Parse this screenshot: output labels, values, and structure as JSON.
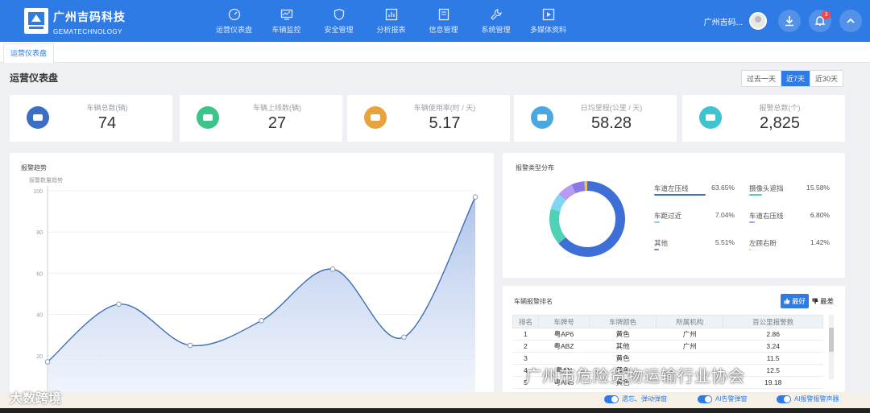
{
  "brand": {
    "name_cn": "广州吉码科技",
    "name_en": "GEMATECHNOLOGY"
  },
  "nav": [
    {
      "label": "运营仪表盘",
      "icon": "dashboard-icon"
    },
    {
      "label": "车辆监控",
      "icon": "monitor-icon"
    },
    {
      "label": "安全管理",
      "icon": "shield-icon"
    },
    {
      "label": "分析报表",
      "icon": "report-icon"
    },
    {
      "label": "信息管理",
      "icon": "document-icon"
    },
    {
      "label": "系统管理",
      "icon": "wrench-icon"
    },
    {
      "label": "多媒体资料",
      "icon": "media-icon"
    }
  ],
  "header": {
    "user_name": "广州吉码...",
    "notification_count": "3"
  },
  "tabs": [
    {
      "label": "运营仪表盘"
    }
  ],
  "page": {
    "title": "运营仪表盘"
  },
  "range": {
    "options": [
      "过去一天",
      "近7天",
      "近30天"
    ],
    "selected": "近7天"
  },
  "stats": [
    {
      "label": "车辆总数(辆)",
      "value": "74",
      "color": "#3b6fc4"
    },
    {
      "label": "车辆上线数(辆)",
      "value": "27",
      "color": "#3cc48a"
    },
    {
      "label": "车辆使用率(时 / 天)",
      "value": "5.17",
      "color": "#e8a33c"
    },
    {
      "label": "日均里程(公里 / 天)",
      "value": "58.28",
      "color": "#4aa8e0"
    },
    {
      "label": "报警总数(个)",
      "value": "2,825",
      "color": "#3fc3cf"
    }
  ],
  "trend": {
    "title": "报警趋势",
    "subtitle": "报警数量趋势"
  },
  "distribution": {
    "title": "报警类型分布"
  },
  "ranking": {
    "title": "车辆报警排名",
    "best_label": "最好",
    "worst_label": "最差",
    "columns": [
      "排名",
      "车牌号",
      "车牌颜色",
      "所属机构",
      "百公里报警数"
    ],
    "rows": [
      [
        "1",
        "粤AP6",
        "黄色",
        "广州",
        "2.86"
      ],
      [
        "2",
        "粤ABZ",
        "其他",
        "广州",
        "3.24"
      ],
      [
        "3",
        "",
        "黄色",
        "",
        "11.5"
      ],
      [
        "4",
        "粤AN",
        "黄色",
        "",
        "12.5"
      ],
      [
        "5",
        "粤AN5",
        "黄色",
        "",
        "19.18"
      ]
    ]
  },
  "bottom": {
    "toggles": [
      "遗忘、弹动弹窗",
      "AI告警弹窗",
      "AI报警报警声器"
    ]
  },
  "watermarks": {
    "left": "大数跨境",
    "right": "广州市危险货物运输行业协会"
  },
  "chart_data": [
    {
      "type": "area",
      "title": "报警趋势",
      "ylabel": "报警数量趋势",
      "ylim": [
        0,
        100
      ],
      "yticks": [
        20,
        40,
        60,
        80,
        100
      ],
      "values": [
        17,
        45,
        25,
        37,
        62,
        29,
        97
      ],
      "color": "#3e6db5"
    },
    {
      "type": "pie",
      "title": "报警类型分布",
      "slices": [
        {
          "name": "车道左压线",
          "value": 63.65,
          "label": "63.65%",
          "color": "#3e6fd6"
        },
        {
          "name": "摄像头遮挡",
          "value": 15.58,
          "label": "15.58%",
          "color": "#4ed1b4"
        },
        {
          "name": "车距过近",
          "value": 7.04,
          "label": "7.04%",
          "color": "#7fd6f2"
        },
        {
          "name": "车道右压线",
          "value": 6.8,
          "label": "6.80%",
          "color": "#b59cf0"
        },
        {
          "name": "其他",
          "value": 5.51,
          "label": "5.51%",
          "color": "#8878e8"
        },
        {
          "name": "左顾右盼",
          "value": 1.42,
          "label": "1.42%",
          "color": "#f0c060"
        }
      ]
    }
  ]
}
